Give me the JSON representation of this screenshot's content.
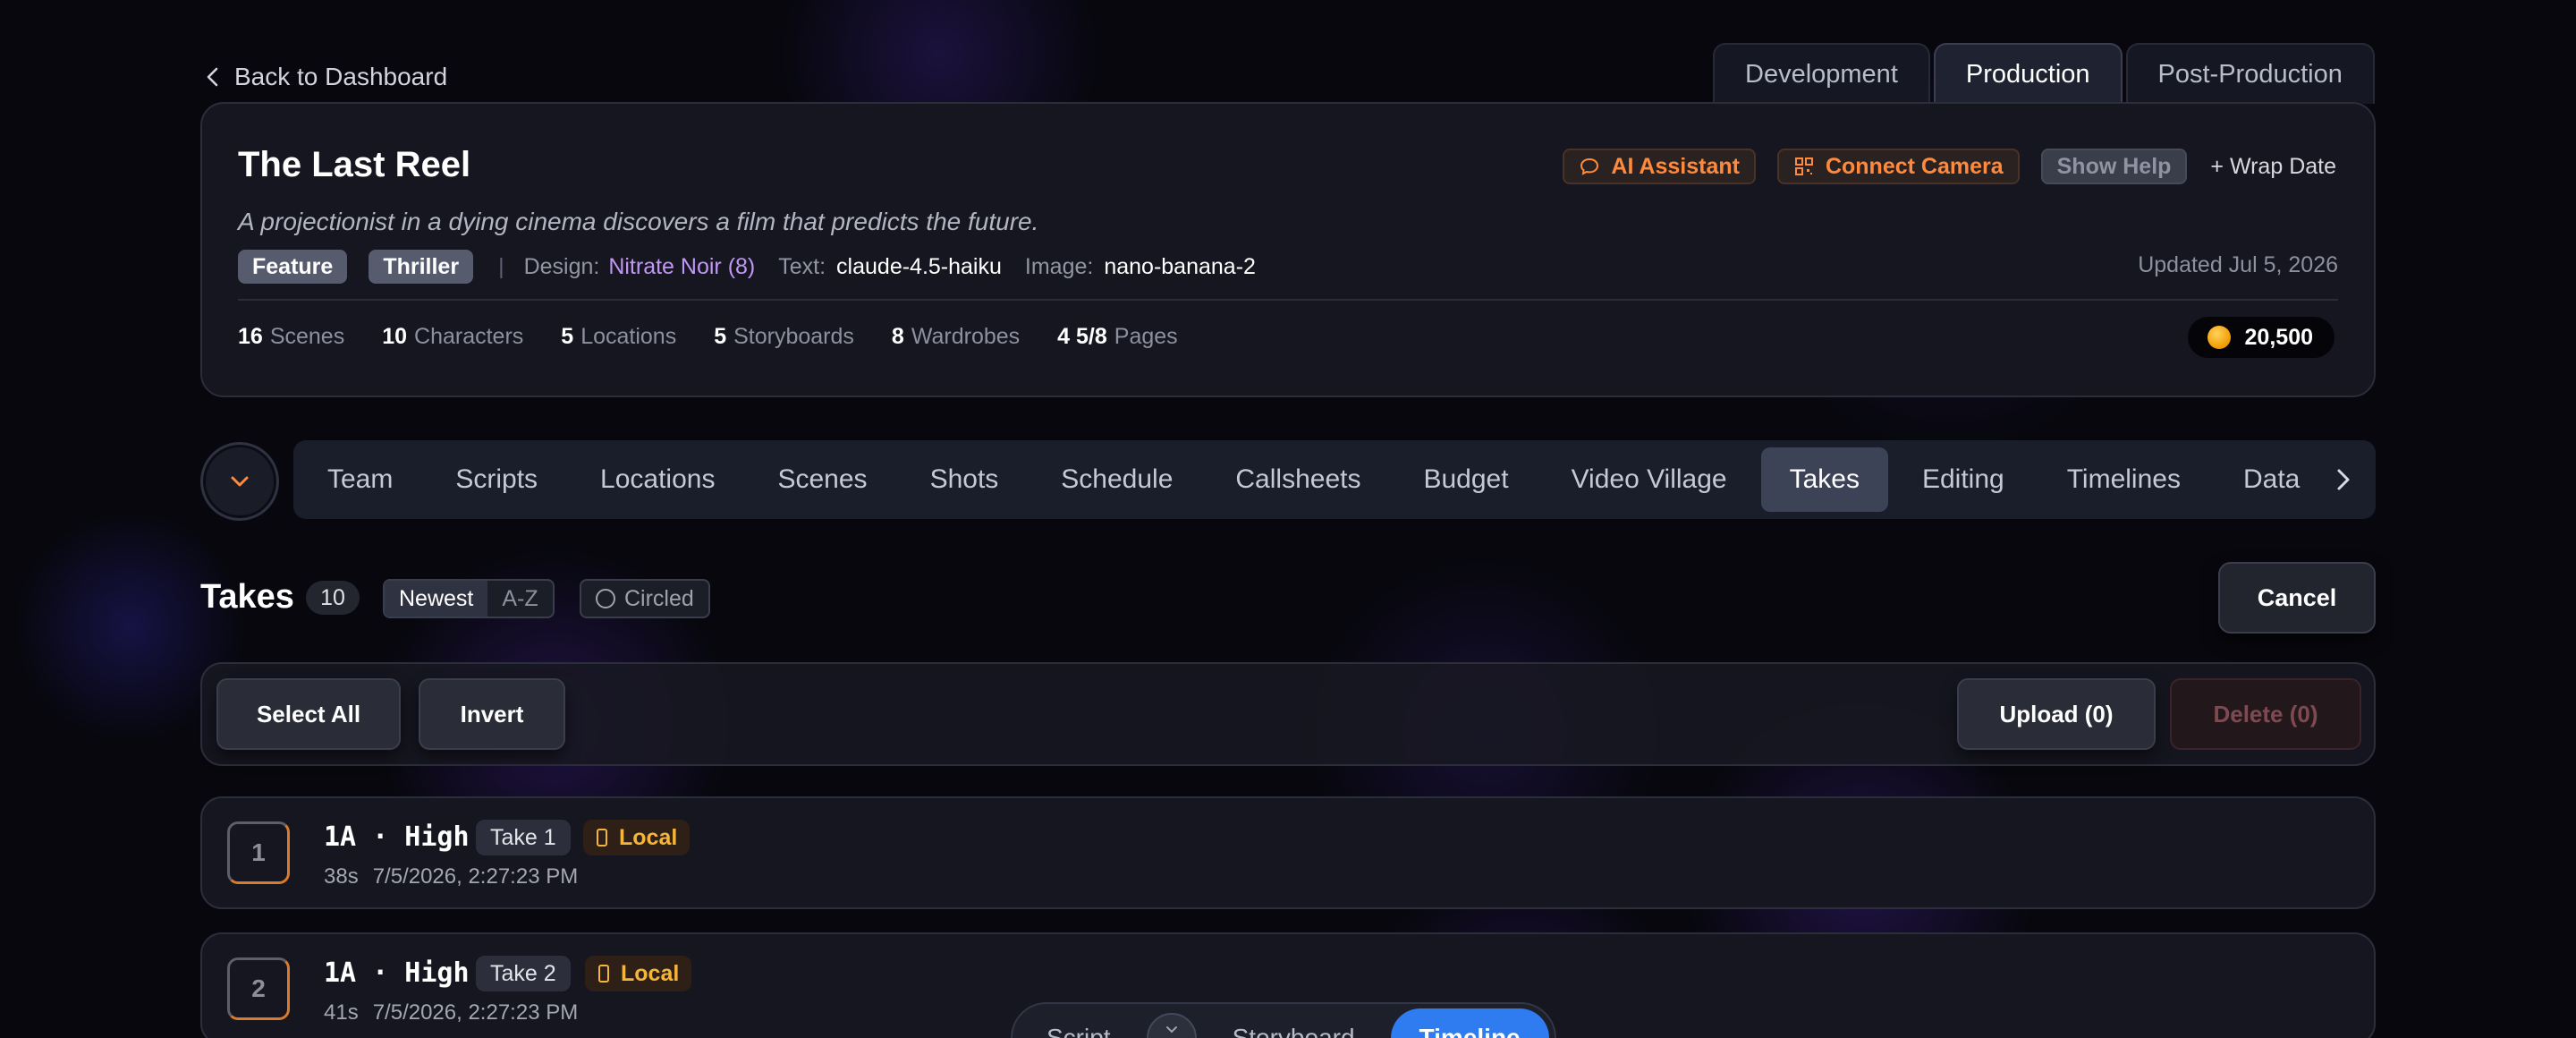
{
  "nav": {
    "back_label": "Back to Dashboard"
  },
  "phase_tabs": [
    {
      "label": "Development",
      "active": false
    },
    {
      "label": "Production",
      "active": true
    },
    {
      "label": "Post-Production",
      "active": false
    }
  ],
  "project": {
    "title": "The Last Reel",
    "logline": "A projectionist in a dying cinema discovers a film that predicts the future.",
    "tags": [
      "Feature",
      "Thriller"
    ],
    "design_label": "Design:",
    "design_value": "Nitrate Noir (8)",
    "text_label": "Text:",
    "text_value": "claude-4.5-haiku",
    "image_label": "Image:",
    "image_value": "nano-banana-2",
    "updated": "Updated Jul 5, 2026",
    "stats": [
      {
        "value": "16",
        "label": "Scenes"
      },
      {
        "value": "10",
        "label": "Characters"
      },
      {
        "value": "5",
        "label": "Locations"
      },
      {
        "value": "5",
        "label": "Storyboards"
      },
      {
        "value": "8",
        "label": "Wardrobes"
      },
      {
        "value": "4 5/8",
        "label": "Pages"
      }
    ],
    "credits": "20,500",
    "actions": {
      "ai_assistant": "AI Assistant",
      "connect_camera": "Connect Camera",
      "show_help": "Show Help",
      "wrap_date": "+ Wrap Date"
    }
  },
  "modules": [
    {
      "label": "Team",
      "active": false
    },
    {
      "label": "Scripts",
      "active": false
    },
    {
      "label": "Locations",
      "active": false
    },
    {
      "label": "Scenes",
      "active": false
    },
    {
      "label": "Shots",
      "active": false
    },
    {
      "label": "Schedule",
      "active": false
    },
    {
      "label": "Callsheets",
      "active": false
    },
    {
      "label": "Budget",
      "active": false
    },
    {
      "label": "Video Village",
      "active": false
    },
    {
      "label": "Takes",
      "active": true
    },
    {
      "label": "Editing",
      "active": false
    },
    {
      "label": "Timelines",
      "active": false
    },
    {
      "label": "Data",
      "active": false
    }
  ],
  "takes": {
    "title": "Takes",
    "count": "10",
    "sort_newest": "Newest",
    "sort_az": "A-Z",
    "filter_circled": "Circled",
    "cancel": "Cancel",
    "toolbar": {
      "select_all": "Select All",
      "invert": "Invert",
      "upload": "Upload (0)",
      "delete": "Delete (0)"
    },
    "items": [
      {
        "index": "1",
        "title": "1A · High",
        "take": "Take 1",
        "storage": "Local",
        "duration": "38s",
        "timestamp": "7/5/2026, 2:27:23 PM"
      },
      {
        "index": "2",
        "title": "1A · High",
        "take": "Take 2",
        "storage": "Local",
        "duration": "41s",
        "timestamp": "7/5/2026, 2:27:23 PM"
      }
    ]
  },
  "view_switch": {
    "options": [
      {
        "label": "Script",
        "active": false
      },
      {
        "label": "Storyboard",
        "active": false
      },
      {
        "label": "Timeline",
        "active": true
      }
    ]
  },
  "colors": {
    "accent_blue": "#2f7bf0",
    "accent_orange": "#ff8a3d",
    "design_purple": "#c196f5",
    "local_amber": "#f5b43a"
  }
}
